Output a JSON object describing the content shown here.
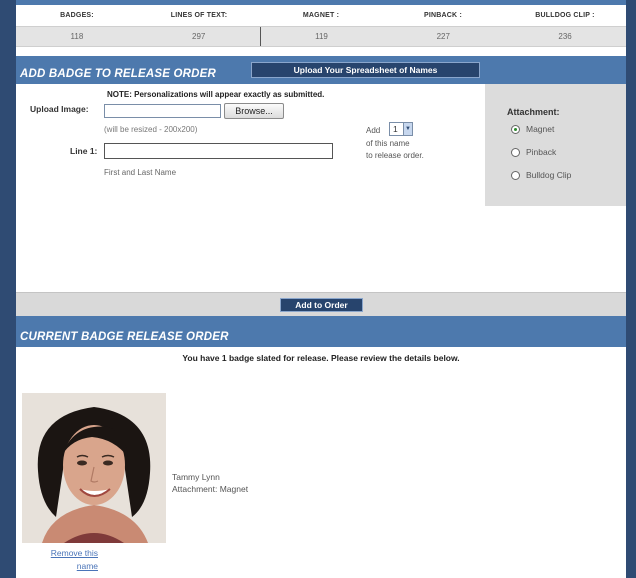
{
  "stats": {
    "headers": [
      "BADGES:",
      "LINES OF TEXT:",
      "MAGNET :",
      "PINBACK :",
      "BULLDOG CLIP :"
    ],
    "values": [
      "118",
      "297",
      "119",
      "227",
      "236"
    ]
  },
  "add_section": {
    "title": "ADD BADGE TO RELEASE ORDER",
    "upload_button": "Upload Your Spreadsheet of Names",
    "note": "NOTE: Personalizations will appear exactly as submitted.",
    "upload_label": "Upload Image:",
    "browse_label": "Browse...",
    "resize_hint": "(will be resized - 200x200)",
    "line1_label": "Line 1:",
    "line1_value": "",
    "line1_hint": "First and Last Name",
    "add_prefix": "Add",
    "qty_value": "1",
    "add_suffix_1": "of this name",
    "add_suffix_2": "to release order.",
    "attachment_title": "Attachment:",
    "attachment_options": [
      "Magnet",
      "Pinback",
      "Bulldog Clip"
    ],
    "attachment_selected": "Magnet",
    "add_to_order": "Add to Order"
  },
  "release_section": {
    "title": "CURRENT BADGE RELEASE ORDER",
    "summary": "You have 1 badge slated for release. Please review the details below.",
    "badge_name": "Tammy Lynn",
    "badge_attachment": "Attachment: Magnet",
    "remove_line1": "Remove this",
    "remove_line2": "name"
  }
}
